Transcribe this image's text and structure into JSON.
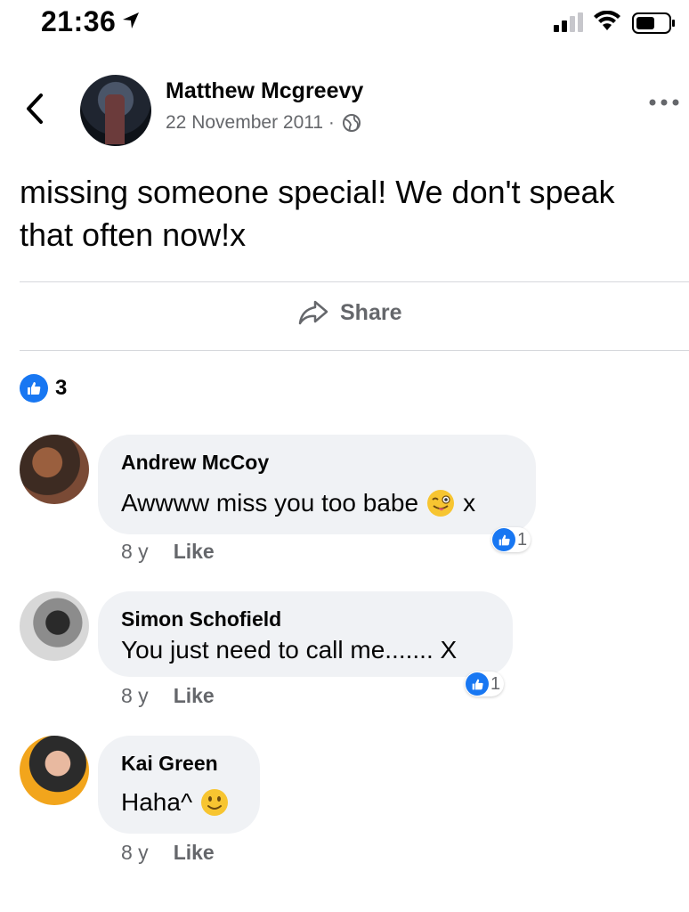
{
  "status_bar": {
    "time": "21:36"
  },
  "post": {
    "author": "Matthew Mcgreevy",
    "date": "22 November 2011 ·",
    "text": "missing someone special! We don't speak that often now!x",
    "share_label": "Share",
    "reaction_count": "3"
  },
  "comments": [
    {
      "name": "Andrew McCoy",
      "text": "Awwww miss you too babe",
      "suffix": "x",
      "emoji": "winking-face-with-tongue",
      "age": "8 y",
      "like_label": "Like",
      "reactions": "1"
    },
    {
      "name": "Simon Schofield",
      "text": "You just need to call me....... X",
      "age": "8 y",
      "like_label": "Like",
      "reactions": "1"
    },
    {
      "name": "Kai Green",
      "text": "Haha^",
      "emoji": "slightly-smiling-face",
      "age": "8 y",
      "like_label": "Like"
    }
  ],
  "colors": {
    "accent": "#1877f2",
    "bubble": "#f0f2f5",
    "secondary_text": "#65676b"
  }
}
